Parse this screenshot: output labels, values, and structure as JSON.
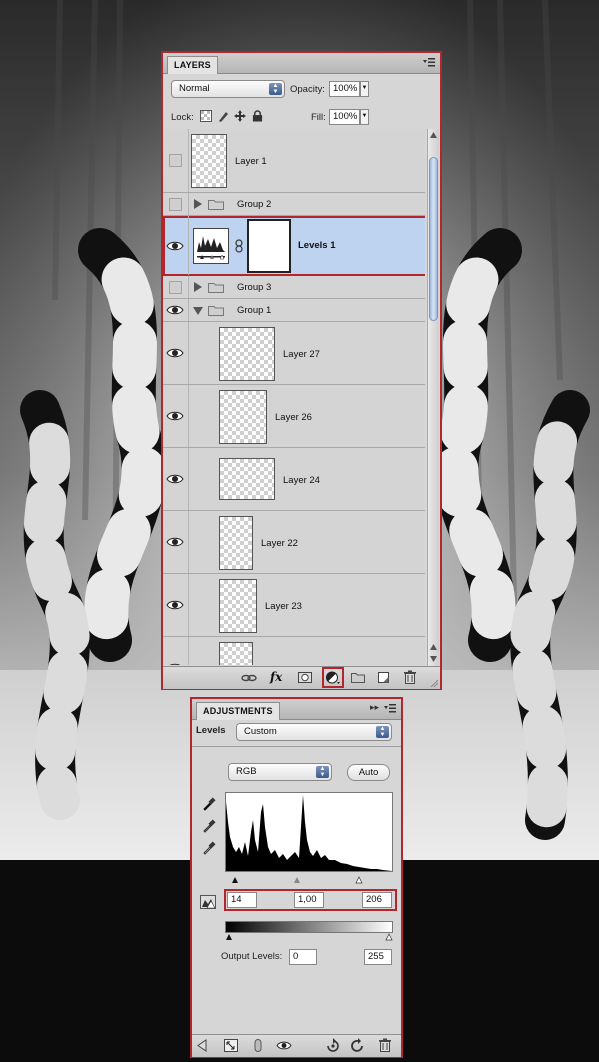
{
  "colors": {
    "highlight_red": "#b3262c",
    "selected_row": "#bed3ef",
    "panel_bg": "#d6d6d6"
  },
  "layers_panel": {
    "tab_title": "LAYERS",
    "blend_mode": "Normal",
    "opacity_label": "Opacity:",
    "opacity_value": "100%",
    "lock_label": "Lock:",
    "fill_label": "Fill:",
    "fill_value": "100%",
    "layers": [
      {
        "name": "Layer 1",
        "kind": "layer",
        "visible": false
      },
      {
        "name": "Group 2",
        "kind": "group",
        "visible": false,
        "expanded": false
      },
      {
        "name": "Levels 1",
        "kind": "adjustment",
        "visible": true,
        "selected": true
      },
      {
        "name": "Group 3",
        "kind": "group",
        "visible": false,
        "expanded": false
      },
      {
        "name": "Group 1",
        "kind": "group",
        "visible": true,
        "expanded": true
      },
      {
        "name": "Layer 27",
        "kind": "layer",
        "visible": true
      },
      {
        "name": "Layer 26",
        "kind": "layer",
        "visible": true
      },
      {
        "name": "Layer 24",
        "kind": "layer",
        "visible": true
      },
      {
        "name": "Layer 22",
        "kind": "layer",
        "visible": true
      },
      {
        "name": "Layer 23",
        "kind": "layer",
        "visible": true
      }
    ],
    "footer_icons": [
      "link-layers-icon",
      "fx-icon",
      "add-mask-icon",
      "adjustment-layer-icon",
      "new-group-icon",
      "new-layer-icon",
      "trash-icon"
    ],
    "fx_label": "fx"
  },
  "adjustments_panel": {
    "tab_title": "ADJUSTMENTS",
    "preset_label": "Levels",
    "preset_value": "Custom",
    "channel_value": "RGB",
    "auto_label": "Auto",
    "input_black": "14",
    "input_gamma": "1,00",
    "input_white": "206",
    "output_label": "Output Levels:",
    "output_black": "0",
    "output_white": "255",
    "footer_icons": [
      "back-arrow-icon",
      "expand-view-icon",
      "clip-icon",
      "visibility-icon",
      "view-previous-icon",
      "reset-icon",
      "trash-icon"
    ]
  }
}
